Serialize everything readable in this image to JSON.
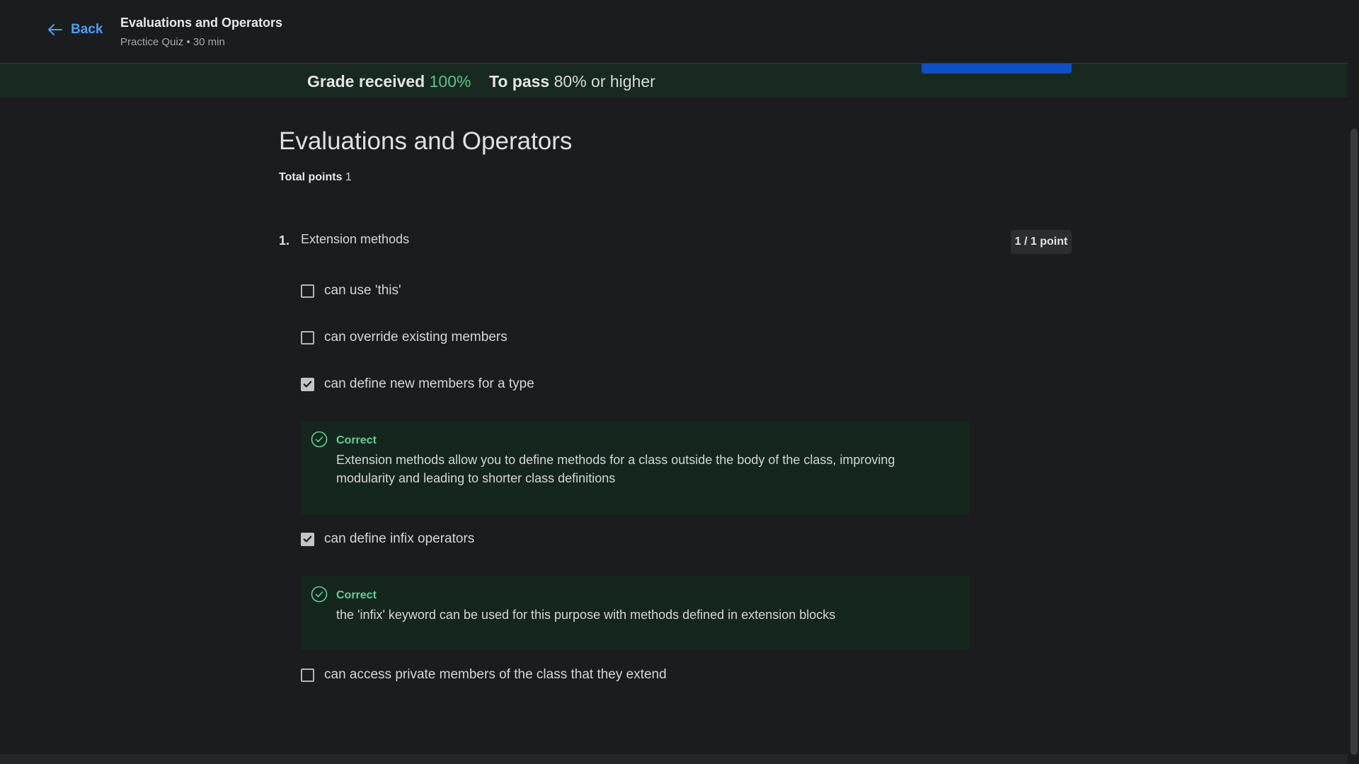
{
  "header": {
    "back_label": "Back",
    "title": "Evaluations and Operators",
    "subtitle": "Practice Quiz • 30 min"
  },
  "grade": {
    "received_label": "Grade received",
    "received_value": "100%",
    "pass_label": "To pass",
    "pass_value": "80% or higher"
  },
  "quiz": {
    "title": "Evaluations and Operators",
    "total_label": "Total points",
    "total_value": "1",
    "question": {
      "number": "1.",
      "text": "Extension methods",
      "points": "1 / 1 point",
      "options": [
        {
          "label": "can use 'this'",
          "checked": false
        },
        {
          "label": "can override existing members",
          "checked": false
        },
        {
          "label": "can define new members for a type",
          "checked": true
        },
        {
          "label": "can define infix operators",
          "checked": true
        },
        {
          "label": "can access private members of the class that they extend",
          "checked": false
        }
      ],
      "feedback": [
        {
          "title": "Correct",
          "text": "Extension methods allow you to define methods for a class outside the body of the class, improving modularity and leading to shorter class definitions"
        },
        {
          "title": "Correct",
          "text": "the 'infix' keyword can be used for this purpose with methods defined in extension blocks"
        }
      ]
    }
  },
  "colors": {
    "accent_link": "#4a9ff5",
    "correct_green": "#55c48d",
    "feedback_bg": "#15261d",
    "primary_button": "#0f4fc6"
  },
  "icons": {
    "back": "arrow-left-icon",
    "correct": "check-circle-icon",
    "checkbox_checked": "checkmark-icon"
  }
}
